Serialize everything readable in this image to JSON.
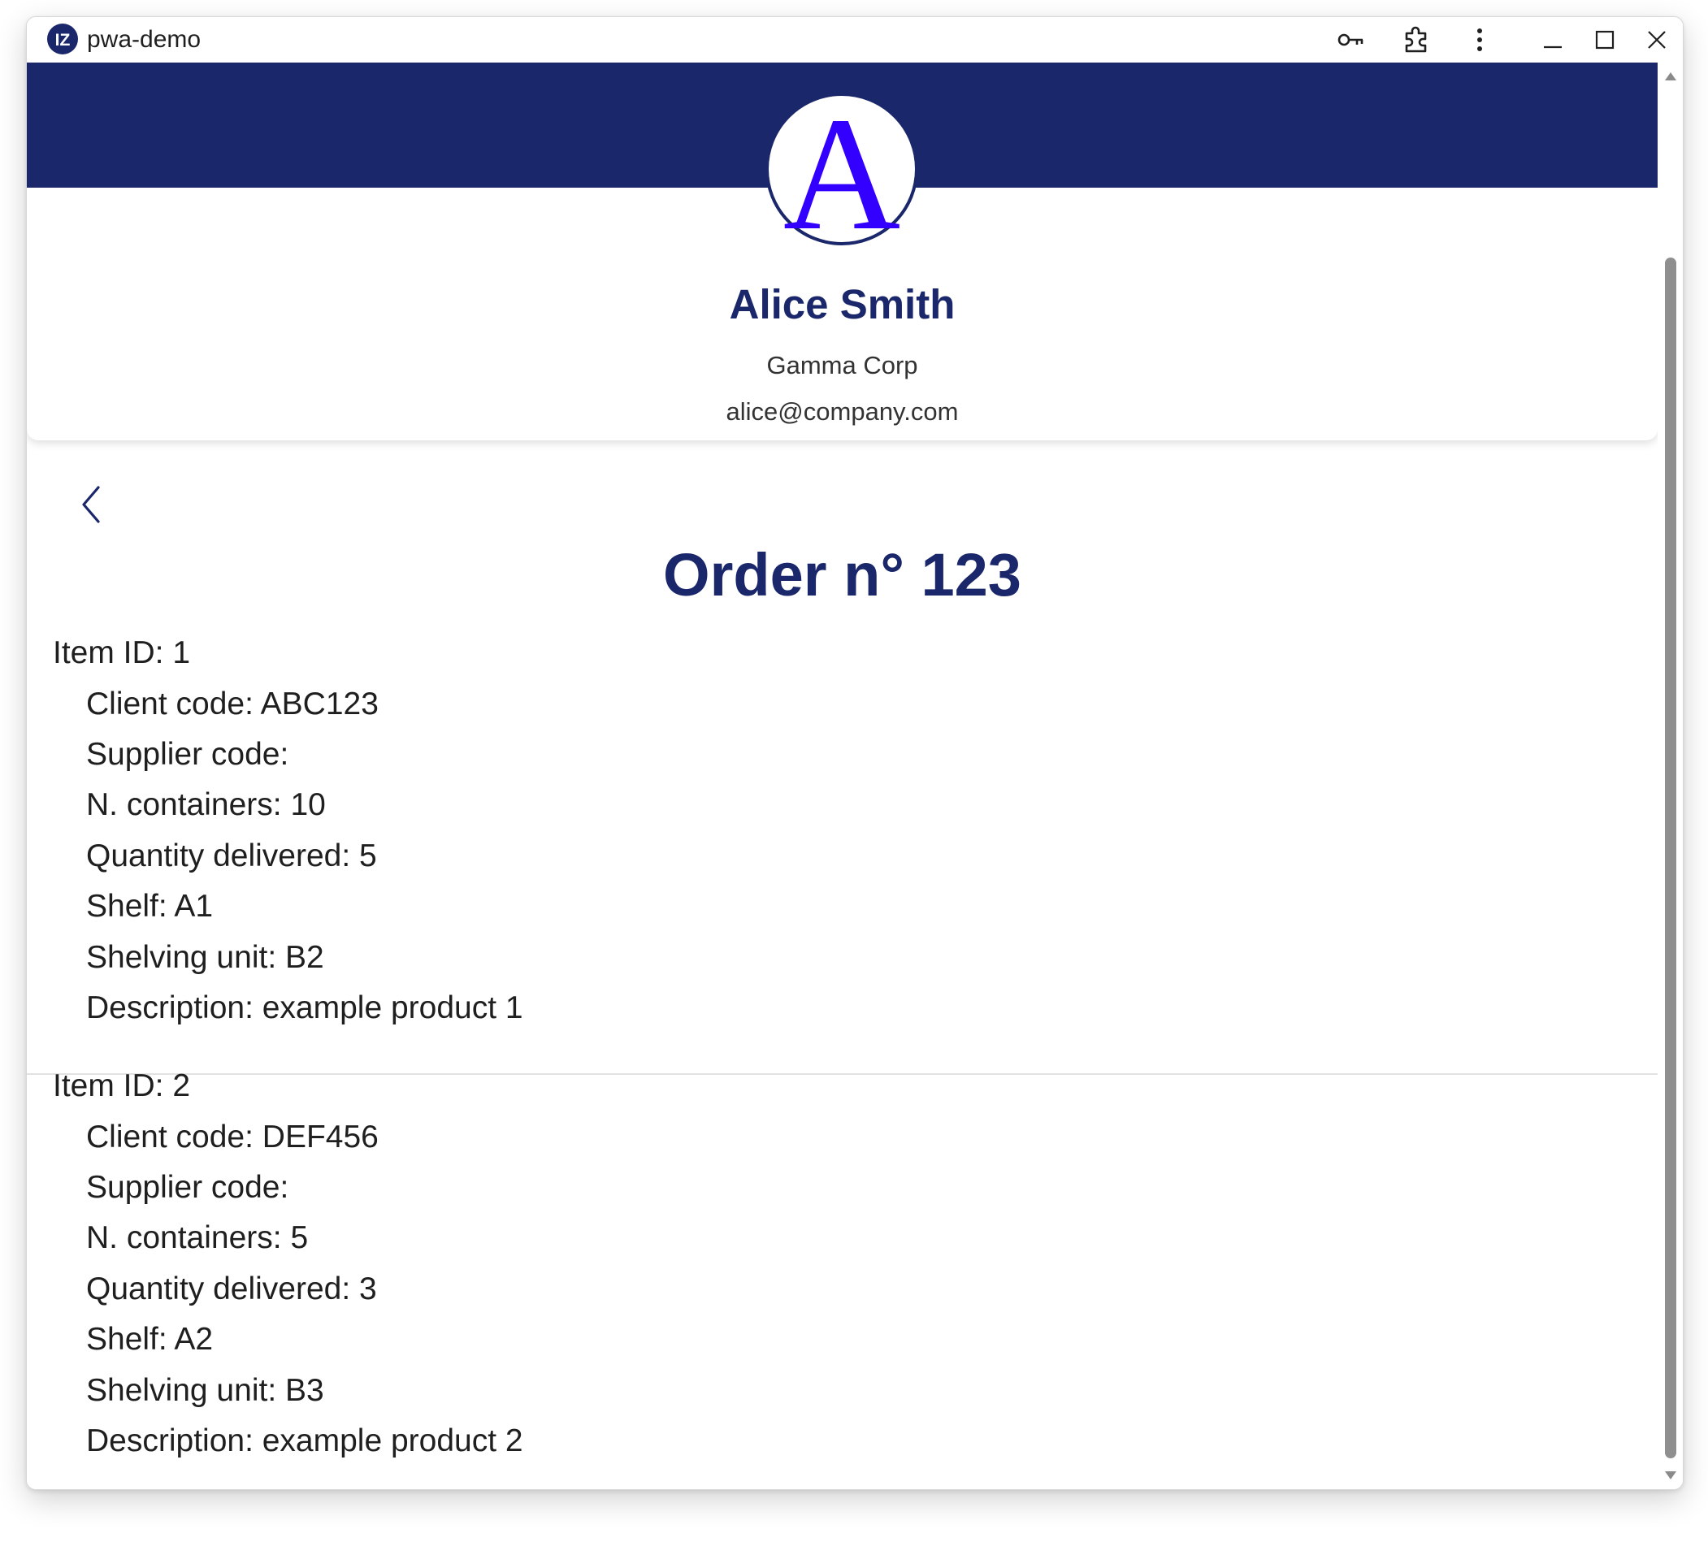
{
  "window": {
    "title": "pwa-demo",
    "logo_text": "IZ"
  },
  "titlebar_icons": [
    "key-icon",
    "extensions-icon",
    "more-options-icon",
    "minimize-icon",
    "maximize-icon",
    "close-icon"
  ],
  "colors": {
    "brand": "#1b276b",
    "avatar_letter": "#3300ff"
  },
  "profile": {
    "avatar_letter": "A",
    "name": "Alice Smith",
    "company": "Gamma Corp",
    "email": "alice@company.com"
  },
  "order": {
    "title": "Order n° 123",
    "items": [
      {
        "id_label": "Item ID: 1",
        "fields": [
          "Client code: ABC123",
          "Supplier code:",
          "N. containers: 10",
          "Quantity delivered: 5",
          "Shelf: A1",
          "Shelving unit: B2",
          "Description: example product 1"
        ]
      },
      {
        "id_label": "Item ID: 2",
        "fields": [
          "Client code: DEF456",
          "Supplier code:",
          "N. containers: 5",
          "Quantity delivered: 3",
          "Shelf: A2",
          "Shelving unit: B3",
          "Description: example product 2"
        ]
      }
    ]
  }
}
